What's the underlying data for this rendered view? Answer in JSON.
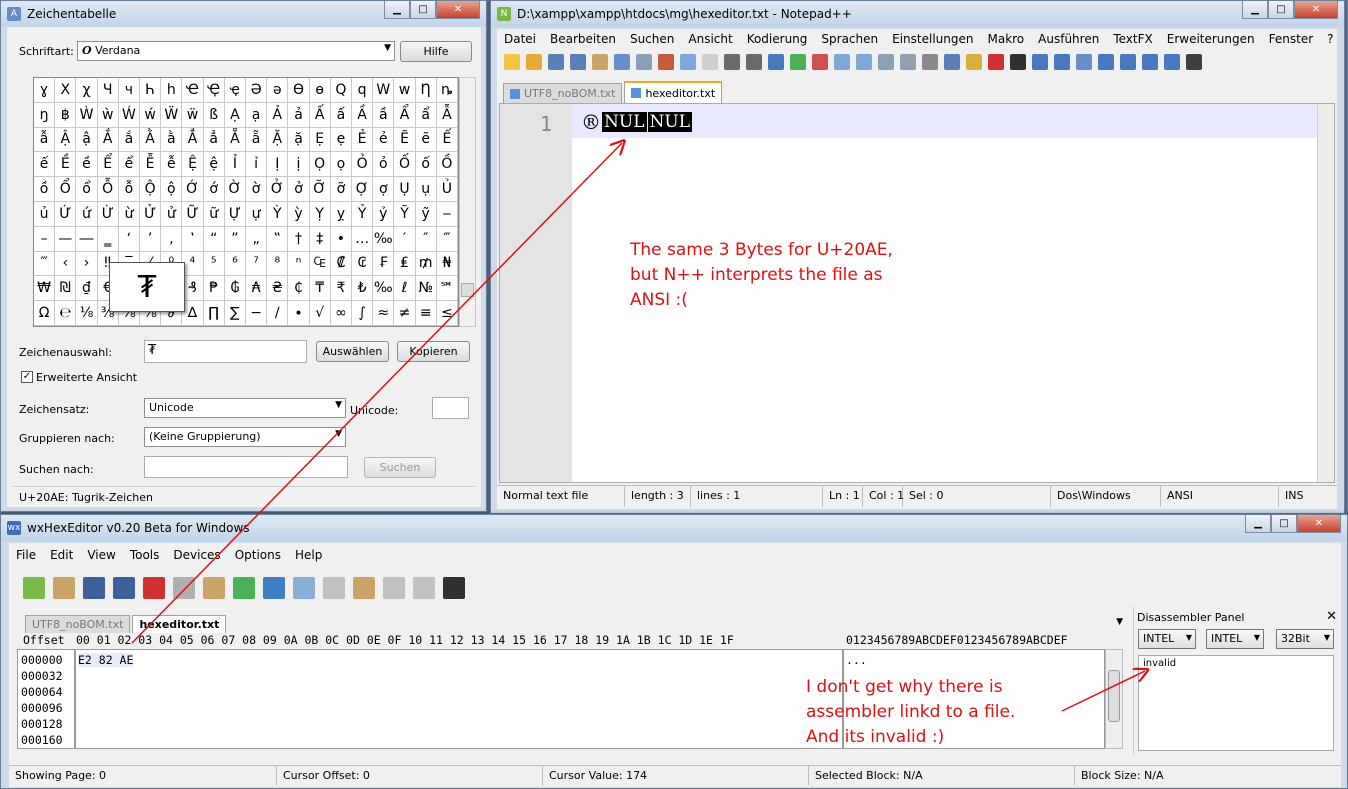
{
  "charmap": {
    "title": "Zeichentabelle",
    "font_label": "Schriftart:",
    "font_value": "Verdana",
    "help_button": "Hilfe",
    "grid": [
      "ɣ",
      "Χ",
      "χ",
      "Ч",
      "ч",
      "Һ",
      "һ",
      "Ҽ",
      "Ҿ",
      "ҿ",
      "Ә",
      "ә",
      "Ѳ",
      "ѳ",
      "Ԛ",
      "ԛ",
      "Ԝ",
      "ԝ",
      "Ƞ",
      "ȵ",
      "ŋ",
      "฿",
      "Ẁ",
      "ẁ",
      "Ẃ",
      "ẃ",
      "Ẅ",
      "ẅ",
      "ß",
      "Ạ",
      "ạ",
      "Ả",
      "ả",
      "Ấ",
      "ấ",
      "Ầ",
      "ầ",
      "Ẩ",
      "ẩ",
      "Ẫ",
      "ẫ",
      "Ậ",
      "ậ",
      "Ắ",
      "ắ",
      "Ằ",
      "ằ",
      "Ẳ",
      "ẳ",
      "Ẵ",
      "ẵ",
      "Ặ",
      "ặ",
      "Ẹ",
      "ẹ",
      "Ẻ",
      "ẻ",
      "Ẽ",
      "ẽ",
      "Ế",
      "ế",
      "Ề",
      "ề",
      "Ể",
      "ể",
      "Ễ",
      "ễ",
      "Ệ",
      "ệ",
      "Ỉ",
      "ỉ",
      "Ị",
      "ị",
      "Ọ",
      "ọ",
      "Ỏ",
      "ỏ",
      "Ố",
      "ố",
      "Ồ",
      "ồ",
      "Ổ",
      "ổ",
      "Ỗ",
      "ỗ",
      "Ộ",
      "ộ",
      "Ớ",
      "ớ",
      "Ờ",
      "ờ",
      "Ở",
      "ở",
      "Ỡ",
      "ỡ",
      "Ợ",
      "ợ",
      "Ụ",
      "ụ",
      "Ủ",
      "ủ",
      "Ứ",
      "ứ",
      "Ừ",
      "ừ",
      "Ử",
      "ử",
      "Ữ",
      "ữ",
      "Ự",
      "ự",
      "Ỳ",
      "ỳ",
      "Ỵ",
      "ỵ",
      "Ỷ",
      "ỷ",
      "Ỹ",
      "ỹ",
      "‒",
      "–",
      "—",
      "―",
      "‗",
      "‘",
      "’",
      "‚",
      "‛",
      "“",
      "”",
      "„",
      "‟",
      "†",
      "‡",
      "•",
      "…",
      "‰",
      "′",
      "″",
      "‴",
      "‴",
      "‹",
      "›",
      "‼",
      "‾",
      "⁄",
      "⁰",
      "⁴",
      "⁵",
      "⁶",
      "⁷",
      "⁸",
      "ⁿ",
      "₠",
      "₡",
      "₢",
      "₣",
      "₤",
      "₥",
      "₦",
      "₩",
      "₪",
      "₫",
      "€",
      "₭",
      "₮",
      "₯",
      "₰",
      "₱",
      "₲",
      "₳",
      "₴",
      "₵",
      "₸",
      "₹",
      "₺",
      "‰",
      "ℓ",
      "№",
      "℠",
      "Ω",
      "℮",
      "⅛",
      "⅜",
      "⅝",
      "⅞",
      "∂",
      "∆",
      "∏",
      "∑",
      "−",
      "∕",
      "∙",
      "√",
      "∞",
      "∫",
      "≈",
      "≠",
      "≡",
      "≤"
    ],
    "preview_char": "₮",
    "selection_label": "Zeichenauswahl:",
    "selection_value": "₮",
    "select_button": "Auswählen",
    "copy_button": "Kopieren",
    "advanced_label": "Erweiterte Ansicht",
    "advanced_checked": "✓",
    "charset_label": "Zeichensatz:",
    "charset_value": "Unicode",
    "unicode_label": "Unicode:",
    "group_label": "Gruppieren nach:",
    "group_value": "(Keine Gruppierung)",
    "search_label": "Suchen nach:",
    "search_button": "Suchen",
    "status": "U+20AE: Tugrik-Zeichen"
  },
  "npp": {
    "title": "D:\\xampp\\xampp\\htdocs\\mg\\hexeditor.txt - Notepad++",
    "menu": [
      "Datei",
      "Bearbeiten",
      "Suchen",
      "Ansicht",
      "Kodierung",
      "Sprachen",
      "Einstellungen",
      "Makro",
      "Ausführen",
      "TextFX",
      "Erweiterungen",
      "Fenster",
      "?"
    ],
    "menu_close": "X",
    "tabs": [
      {
        "label": "UTF8_noBOM.txt"
      },
      {
        "label": "hexeditor.txt"
      }
    ],
    "line_number": "1",
    "code_char": "®",
    "nul1": "NUL",
    "nul2": "NUL",
    "status": {
      "type": "Normal text file",
      "length": "length : 3",
      "lines": "lines : 1",
      "ln": "Ln : 1",
      "col": "Col : 1",
      "sel": "Sel : 0",
      "eol": "Dos\\Windows",
      "enc": "ANSI",
      "ins": "INS"
    }
  },
  "hex": {
    "title": "wxHexEditor v0.20 Beta for Windows",
    "menu": [
      "File",
      "Edit",
      "View",
      "Tools",
      "Devices",
      "Options",
      "Help"
    ],
    "tabs": [
      {
        "label": "UTF8_noBOM.txt"
      },
      {
        "label": "hexeditor.txt"
      }
    ],
    "offset_header": "Offset",
    "col_header": "00 01 02 03 04 05 06 07 08 09 0A 0B 0C 0D 0E 0F 10 11 12 13 14 15 16 17 18 19 1A 1B 1C 1D 1E 1F",
    "ascii_header": "0123456789ABCDEF0123456789ABCDEF",
    "offsets": [
      "000000",
      "000032",
      "000064",
      "000096",
      "000128",
      "000160"
    ],
    "bytes_row": "E2 82 AE",
    "ascii_row": "...",
    "disasm_title": "Disassembler Panel",
    "disasm_close": "✕",
    "disasm_opts": [
      "INTEL",
      "INTEL",
      "32Bit"
    ],
    "disasm_text": "invalid",
    "status": {
      "page": "Showing Page: 0",
      "offset": "Cursor Offset: 0",
      "value": "Cursor Value: 174",
      "block": "Selected Block: N/A",
      "size": "Block Size: N/A"
    }
  },
  "annotations": {
    "note1": "The same 3 Bytes for U+20AE,\nbut N++ interprets the file as\nANSI :(",
    "note2": "I don't get why there is\nassembler linkd to a file.\nAnd its invalid :)",
    "color": "#e01010"
  },
  "colors": {
    "npp_tab_accent": "#f5a623",
    "highlight": "#e8e8ff"
  }
}
